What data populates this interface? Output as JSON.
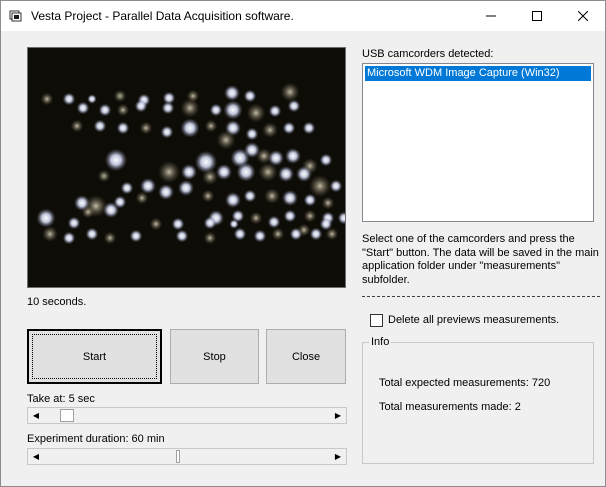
{
  "window": {
    "title": "Vesta Project - Parallel Data Acquisition software."
  },
  "preview": {
    "status": "10 seconds."
  },
  "buttons": {
    "start": "Start",
    "stop": "Stop",
    "close": "Close"
  },
  "take_at": {
    "label": "Take at: 5 sec",
    "position_fraction": 0.06
  },
  "duration": {
    "label": "Experiment duration: 60 min",
    "position_fraction": 0.48
  },
  "usb": {
    "label": "USB camcorders detected:",
    "devices": [
      "Microsoft WDM Image Capture (Win32)"
    ],
    "selected_index": 0
  },
  "instructions": "Select one of the camcorders and press the \"Start\" button. The data will be saved in the main application folder under \"measurements\" subfolder.",
  "delete_option": {
    "label": "Delete all previews measurements.",
    "checked": false
  },
  "info": {
    "title": "Info",
    "expected": "Total expected measurements: 720",
    "made": "Total measurements made: 2"
  },
  "colors": {
    "selection": "#0078d7",
    "window_bg": "#f0f0f0",
    "preview_bg": "#0d0c06"
  },
  "icons": [
    "app-icon",
    "minimize-icon",
    "maximize-icon",
    "close-icon",
    "scroll-left-arrow-icon",
    "scroll-right-arrow-icon"
  ]
}
